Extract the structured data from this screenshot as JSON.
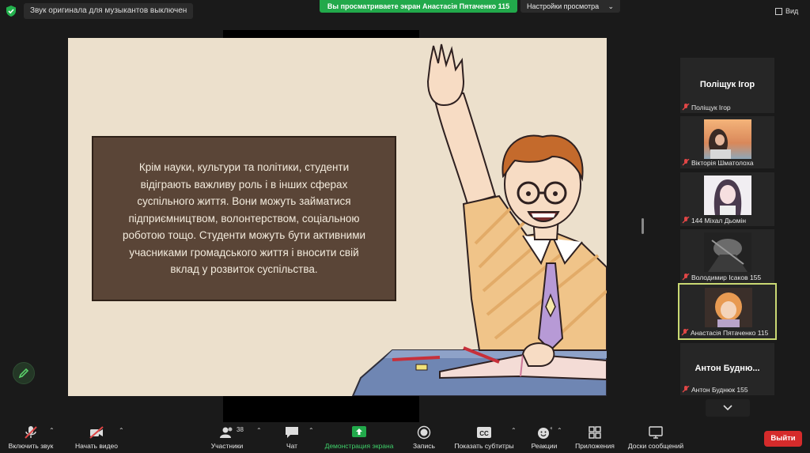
{
  "top_bar": {
    "music_notice": "Звук оригинала для музыкантов выключен",
    "share_banner": "Вы просматриваете экран Анастасія Пятаченко 115",
    "view_settings": "Настройки просмотра",
    "view_button": "Вид"
  },
  "slide": {
    "text": "Крім науки, культури та політики, студенти відіграють важливу роль і в інших сферах суспільного життя. Вони можуть займатися підприємництвом, волонтерством, соціальною роботою тощо. Студенти можуть бути активними учасниками громадського життя і вносити свій вклад у розвиток суспільства."
  },
  "participants": [
    {
      "display": "Поліщук Ігор",
      "name": "Поліщук Ігор",
      "muted": true
    },
    {
      "name": "Вікторія Шматолоха",
      "muted": true,
      "photo": "sunset"
    },
    {
      "name": "144 Міхал Дьомін",
      "muted": true,
      "photo": "anime"
    },
    {
      "name": "Володимир Ісаков 155",
      "muted": true,
      "photo": "mono"
    },
    {
      "name": "Анастасія Пятаченко 115",
      "muted": true,
      "photo": "red-hair",
      "active": true
    },
    {
      "display": "Антон Будню...",
      "name": "Антон Буднюк 155",
      "muted": true
    }
  ],
  "toolbar": {
    "unmute": "Включить звук",
    "start_video": "Начать видео",
    "participants": "Участники",
    "participants_count": "38",
    "chat": "Чат",
    "share_screen": "Демонстрация экрана",
    "record": "Запись",
    "captions": "Показать субтитры",
    "reactions": "Реакции",
    "apps": "Приложения",
    "whiteboards": "Доски сообщений",
    "leave": "Выйти"
  },
  "colors": {
    "share_green": "#22a94b",
    "leave_red": "#d52b2b",
    "active_speaker_border": "#c9d873",
    "slide_bg": "#ece0cc",
    "text_box": "#5a4537"
  }
}
